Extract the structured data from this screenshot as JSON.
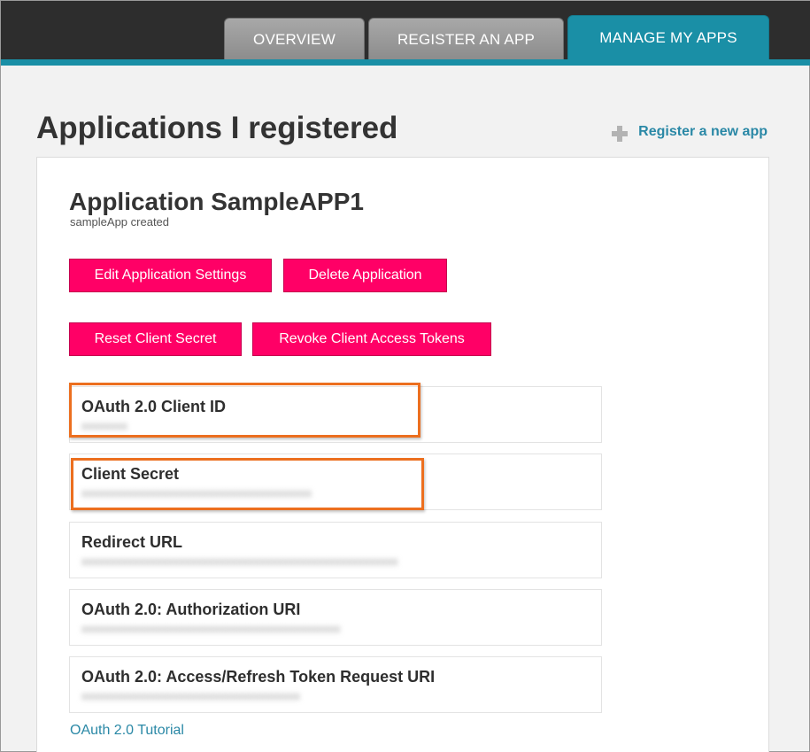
{
  "header": {
    "tabs": [
      {
        "label": "OVERVIEW",
        "active": false
      },
      {
        "label": "REGISTER AN APP",
        "active": false
      },
      {
        "label": "MANAGE MY APPS",
        "active": true
      }
    ]
  },
  "page": {
    "title": "Applications I registered",
    "register_link": "Register a new app"
  },
  "app": {
    "title": "Application SampleAPP1",
    "subtitle": "sampleApp created",
    "buttons": {
      "edit": "Edit Application Settings",
      "delete": "Delete Application",
      "reset_secret": "Reset Client Secret",
      "revoke_tokens": "Revoke Client Access Tokens"
    },
    "fields": [
      {
        "label": "OAuth 2.0 Client ID",
        "value": "xxxxxxxx"
      },
      {
        "label": "Client Secret",
        "value": "xxxxxxxxxxxxxxxxxxxxxxxxxxxxxxxxxxxxxxxx"
      },
      {
        "label": "Redirect URL",
        "value": "xxxxxxxxxxxxxxxxxxxxxxxxxxxxxxxxxxxxxxxxxxxxxxxxxxxxxxx"
      },
      {
        "label": "OAuth 2.0: Authorization URI",
        "value": "xxxxxxxxxxxxxxxxxxxxxxxxxxxxxxxxxxxxxxxxxxxxx"
      },
      {
        "label": "OAuth 2.0: Access/Refresh Token Request URI",
        "value": "xxxxxxxxxxxxxxxxxxxxxxxxxxxxxxxxxxxxxx"
      }
    ],
    "tutorial_link": "OAuth 2.0 Tutorial"
  },
  "colors": {
    "accent": "#1a8fa6",
    "button": "#ff0066",
    "highlight": "#ec6f1f",
    "link": "#2a88a6"
  },
  "icons": {
    "register_link": "plus-icon"
  }
}
